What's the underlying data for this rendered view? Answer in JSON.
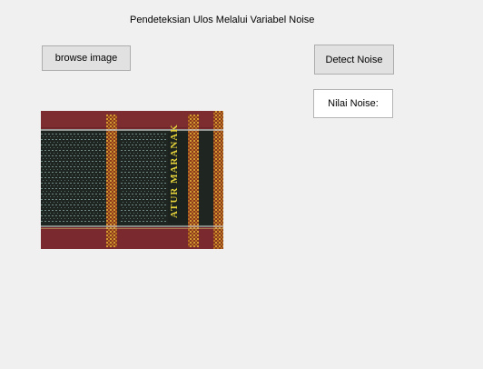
{
  "window": {
    "title": "Pendeteksian Ulos Melalui Variabel Noise"
  },
  "buttons": {
    "browse_label": "browse image",
    "detect_label": "Detect Noise"
  },
  "noise": {
    "label": "Nilai Noise:"
  },
  "image": {
    "subject": "ulos-textile-photo",
    "woven_text": "ATUR MARANAK",
    "colors": {
      "maroon": "#7a2a2e",
      "maroon_dark": "#5e1e22",
      "dark_center": "#1f2622",
      "gold": "#c98a2a",
      "woven_yellow": "#e5d23a"
    }
  }
}
